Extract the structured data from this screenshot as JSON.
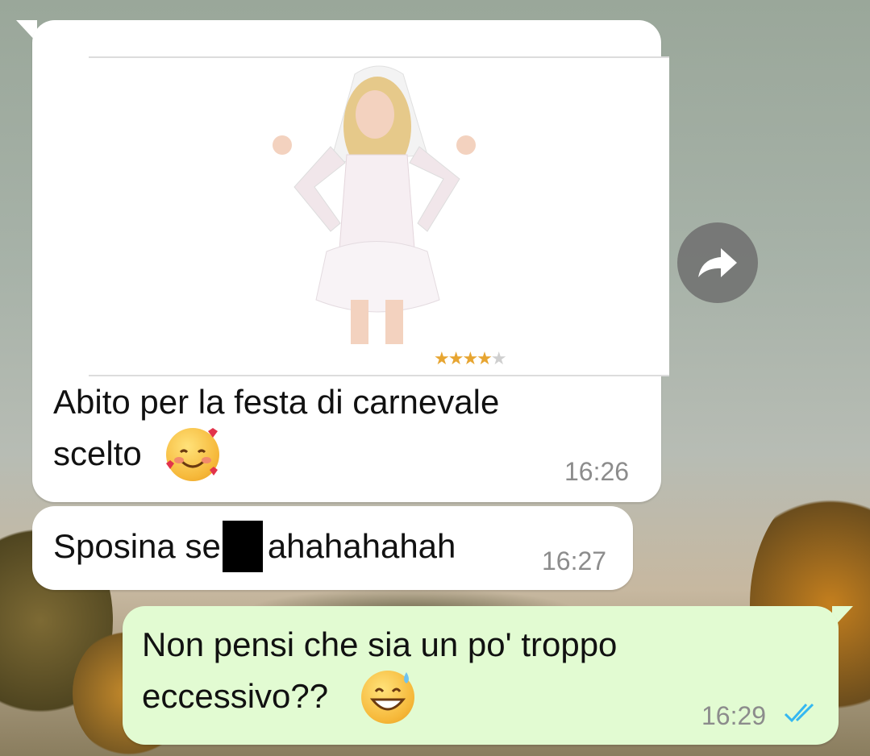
{
  "messages": [
    {
      "direction": "incoming",
      "text": "Abito per la festa di carnevale\nscelto",
      "time": "16:26",
      "link_preview": {
        "rating": 3.5,
        "rating_max": 5,
        "image": "bride-costume-photo"
      }
    },
    {
      "direction": "incoming",
      "text_before": "Sposina se",
      "text_after": "ahahahahah",
      "redacted": true,
      "time": "16:27"
    },
    {
      "direction": "outgoing",
      "text": "Non pensi che sia un po' troppo\neccessivo??",
      "time": "16:29",
      "status": "read"
    }
  ],
  "icons": {
    "forward": "forward-arrow-icon",
    "read_receipt": "double-check-icon",
    "emoji_1": "smiling-face-with-hearts",
    "emoji_2": "grinning-face-with-sweat"
  },
  "colors": {
    "incoming_bubble": "#ffffff",
    "outgoing_bubble": "#e2fbd2",
    "read_tick": "#34b7f1",
    "timestamp": "#8c8c8c"
  }
}
